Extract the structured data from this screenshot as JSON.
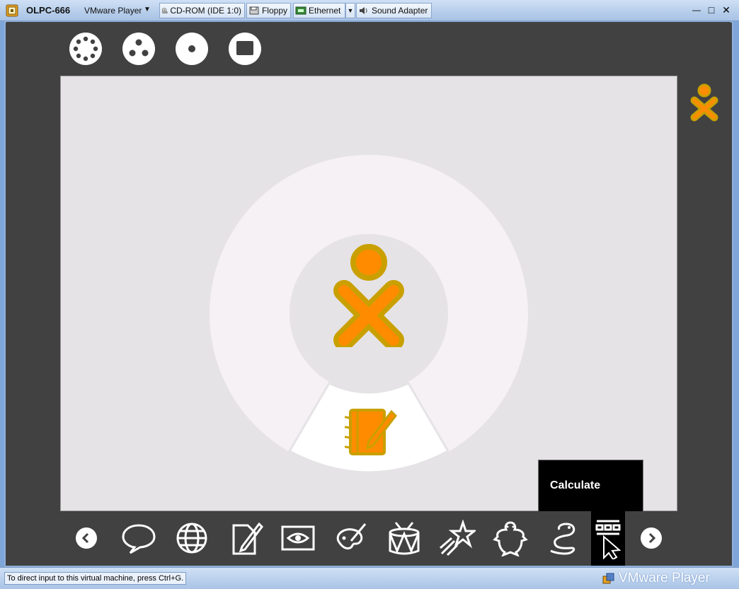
{
  "window": {
    "vm_name": "OLPC-666",
    "menu_label": "VMware Player"
  },
  "devices": [
    {
      "label": "CD-ROM (IDE 1:0)",
      "icon": "cdrom-icon"
    },
    {
      "label": "Floppy",
      "icon": "floppy-icon"
    },
    {
      "label": "Ethernet",
      "icon": "ethernet-icon"
    },
    {
      "label": "Sound Adapter",
      "icon": "sound-icon"
    }
  ],
  "window_controls": {
    "minimize": "—",
    "maximize": "□",
    "close": "✕"
  },
  "sugar": {
    "zoom_views": [
      "neighborhood-view-icon",
      "group-view-icon",
      "home-view-icon",
      "activity-view-icon"
    ],
    "tooltip": "Calculate",
    "activities": [
      "chat-icon",
      "browse-icon",
      "write-icon",
      "record-icon",
      "paint-icon",
      "tamtam-icon",
      "turtle-art-icon",
      "etoys-icon",
      "pippy-icon",
      "calculate-icon"
    ],
    "colors": {
      "xo_fill": "#ff8c00",
      "xo_stroke": "#c9a000",
      "frame_bg": "#414141"
    }
  },
  "status": {
    "hint": "To direct input to this virtual machine, press Ctrl+G.",
    "brand": "VMware Player"
  }
}
